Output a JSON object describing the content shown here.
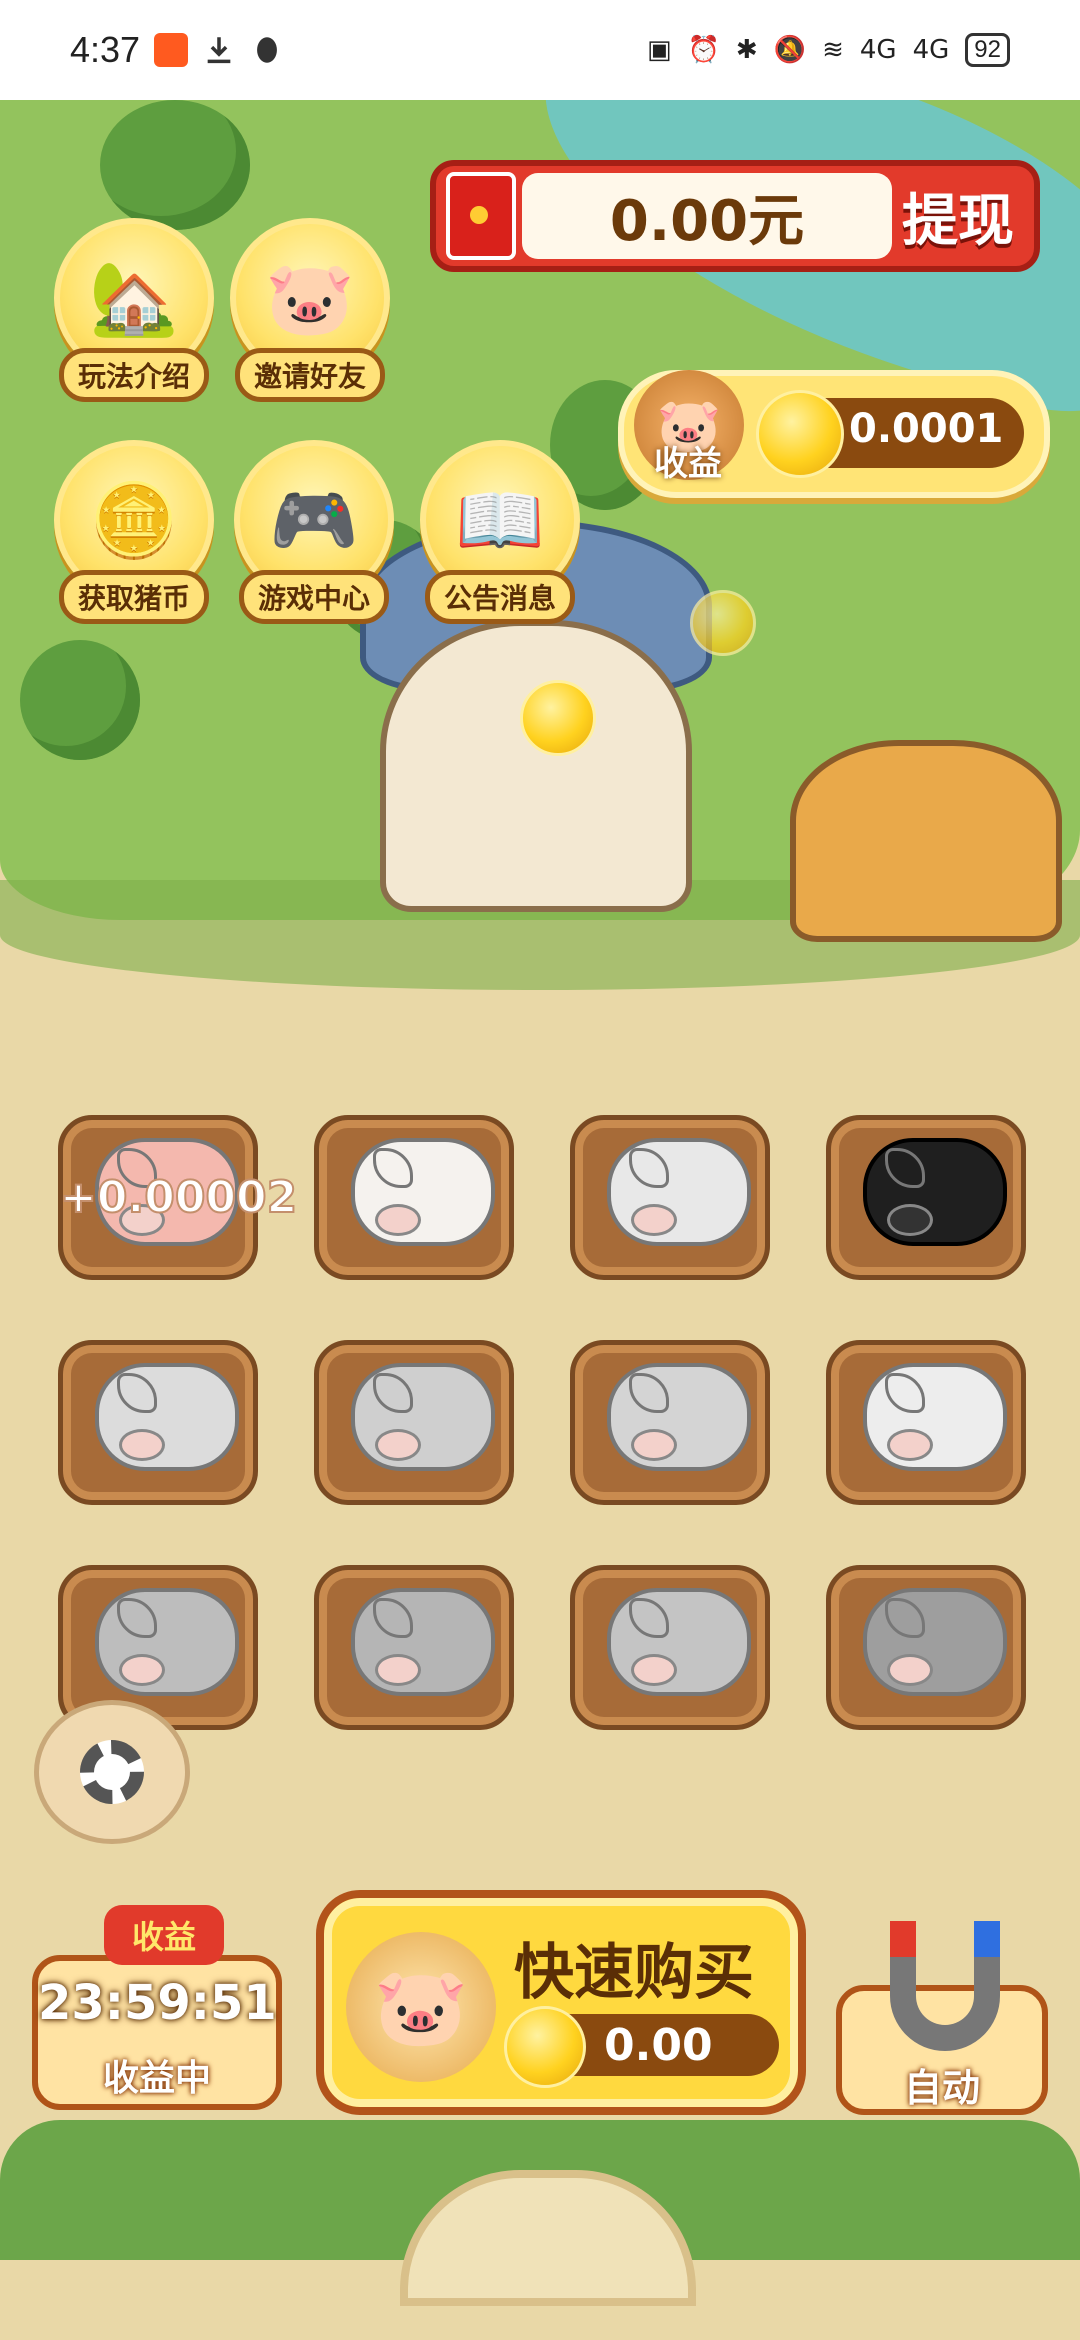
{
  "status_bar": {
    "time": "4:37",
    "battery": "92",
    "network_a": "4G",
    "network_b": "4G"
  },
  "menu": {
    "how_to_play": "玩法介绍",
    "invite_friends": "邀请好友",
    "get_pig_coins": "获取猪币",
    "game_center": "游戏中心",
    "announcements": "公告消息"
  },
  "withdraw": {
    "amount": "0.00元",
    "button": "提现"
  },
  "income": {
    "label": "收益",
    "value": "0.0001"
  },
  "pigs": {
    "floating_earning": "+0.00002",
    "pens": [
      {
        "color": "#F4B8AE",
        "locked": false
      },
      {
        "color": "#F5F2EE",
        "locked": false
      },
      {
        "color": "#E8E8E8",
        "locked": false
      },
      {
        "color": "#1F1F1F",
        "locked": false
      },
      {
        "color": "#DCDCDC",
        "locked": true
      },
      {
        "color": "#CFCFCF",
        "locked": true
      },
      {
        "color": "#D4D4D4",
        "locked": true
      },
      {
        "color": "#EDEDED",
        "locked": true
      },
      {
        "color": "#BDBDBD",
        "locked": true
      },
      {
        "color": "#B5B5B5",
        "locked": true
      },
      {
        "color": "#C4C4C4",
        "locked": true
      },
      {
        "color": "#9E9E9E",
        "locked": true
      }
    ]
  },
  "bottom": {
    "timer_tag": "收益",
    "timer": "23:59:51",
    "timer_status": "收益中",
    "quick_buy": "快速购买",
    "quick_buy_price": "0.00",
    "auto": "自动"
  },
  "colors": {
    "grass": "#93C35D",
    "ground": "#E9D8A7",
    "accent_red": "#E23A2B",
    "accent_yellow": "#FFD93F"
  }
}
